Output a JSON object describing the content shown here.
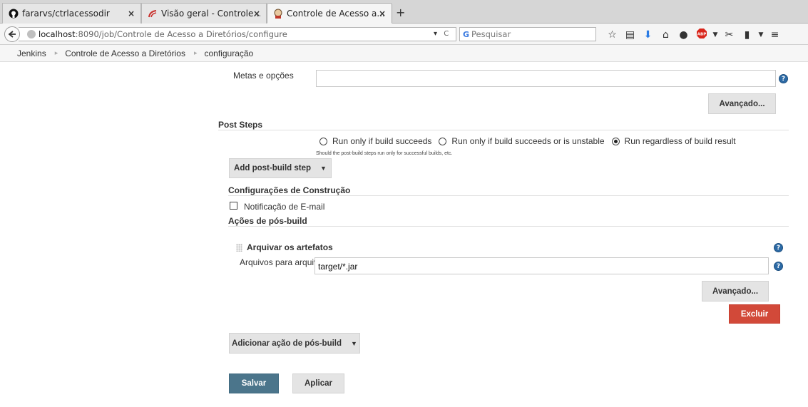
{
  "browser": {
    "tabs": [
      {
        "title": "fararvs/ctrlacessodir",
        "icon": "github-icon"
      },
      {
        "title": "Visão geral - Controle...",
        "icon": "sonarqube-icon"
      },
      {
        "title": "Controle de Acesso a...",
        "icon": "jenkins-icon",
        "active": true
      }
    ],
    "close_glyph": "×",
    "new_tab_glyph": "+",
    "url_host": "localhost",
    "url_rest": ":8090/job/Controle de Acesso a Diretórios/configure",
    "url_dropdown_glyph": "▾",
    "reload_glyph": "C",
    "search_placeholder": "Pesquisar",
    "toolbar_icons": [
      "bookmark-star-icon",
      "reading-list-icon",
      "download-icon",
      "home-icon",
      "chat-icon",
      "adblock-icon",
      "dropdown-icon",
      "extension-icon",
      "clipboard-icon",
      "dropdown-icon",
      "menu-icon"
    ]
  },
  "breadcrumbs": {
    "items": [
      "Jenkins",
      "Controle de Acesso a Diretórios",
      "configuração"
    ],
    "separator": "▸"
  },
  "form": {
    "goals": {
      "label": "Metas e opções",
      "value": ""
    },
    "advanced_label": "Avançado...",
    "help_glyph": "?",
    "post_steps": {
      "title": "Post Steps",
      "options": [
        {
          "label": "Run only if build succeeds",
          "checked": false
        },
        {
          "label": "Run only if build succeeds or is unstable",
          "checked": false
        },
        {
          "label": "Run regardless of build result",
          "checked": true
        }
      ],
      "note": "Should the post-build steps run only for successful builds, etc.",
      "add_button": "Add post-build step"
    },
    "build_settings": {
      "title": "Configurações de Construção",
      "email_label": "Notificação de E-mail",
      "email_checked": false
    },
    "post_build": {
      "title": "Ações de pós-build",
      "archive": {
        "title": "Arquivar os artefatos",
        "files_label": "Arquivos para arquivar",
        "files_value": "target/*.jar",
        "advanced_label": "Avançado...",
        "delete_label": "Excluir"
      },
      "add_button": "Adicionar ação de pós-build"
    },
    "save_label": "Salvar",
    "apply_label": "Aplicar"
  },
  "colors": {
    "primary_button": "#4b758b",
    "danger_button": "#d24939",
    "help_icon": "#2c6aa5"
  }
}
